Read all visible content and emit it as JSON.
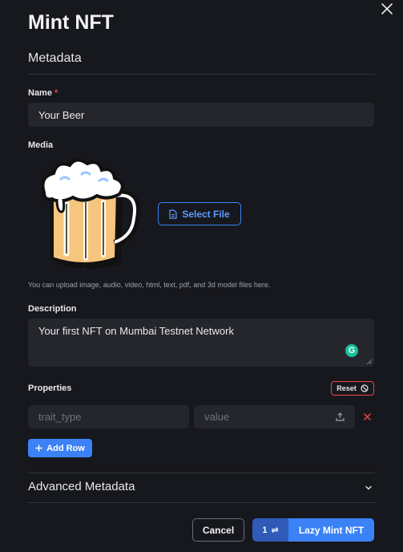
{
  "modal": {
    "title": "Mint NFT",
    "section_title": "Metadata"
  },
  "form": {
    "name_label": "Name",
    "required_mark": "*",
    "name_value": "Your Beer",
    "media_label": "Media",
    "select_file_label": "Select File",
    "media_help": "You can upload image, audio, video, html, text, pdf, and 3d model files here.",
    "description_label": "Description",
    "description_value": "Your first NFT on Mumbai Testnet Network",
    "grammarly_glyph": "G",
    "properties_label": "Properties",
    "reset_label": "Reset",
    "trait_type_placeholder": "trait_type",
    "value_placeholder": "value",
    "add_row_label": "Add Row",
    "advanced_label": "Advanced Metadata"
  },
  "footer": {
    "cancel_label": "Cancel",
    "quantity": "1",
    "quantity_icon": "⇌",
    "mint_label": "Lazy Mint NFT"
  },
  "icons": {
    "close": "close-icon",
    "file": "file-icon",
    "upload": "upload-icon",
    "remove": "remove-icon",
    "add": "plus-icon",
    "reset": "ban-icon",
    "chevron": "chevron-down-icon"
  },
  "colors": {
    "background": "#17181d",
    "input_bg": "#25262c",
    "accent": "#3b82f6",
    "danger": "#e5484d"
  }
}
